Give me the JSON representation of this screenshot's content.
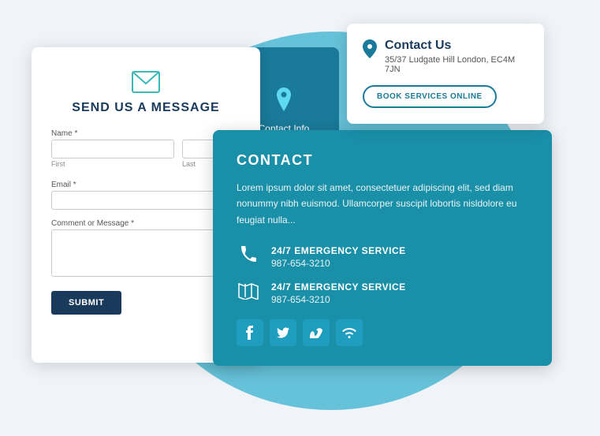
{
  "background": {
    "blob_color": "#4db8d4"
  },
  "form_card": {
    "title": "SEND US A MESSAGE",
    "envelope_icon": "✉",
    "name_label": "Name *",
    "name_first_label": "First",
    "name_last_label": "Last",
    "email_label": "Email *",
    "comment_label": "Comment or Message *",
    "submit_label": "SUBMIT"
  },
  "tab_card": {
    "pin_icon": "📍",
    "label": "Contact Info"
  },
  "contact_us_card": {
    "pin_icon": "📍",
    "title": "Contact Us",
    "address": "35/37 Ludgate Hill London, EC4M 7JN",
    "book_btn": "BOOK SERVICES ONLINE"
  },
  "main_contact_card": {
    "title": "CONTACT",
    "description": "Lorem ipsum dolor sit amet, consectetuer adipiscing elit, sed diam nonummy nibh euismod. Ullamcorper suscipit lobortis nisldolore eu feugiat nulla...",
    "service1": {
      "icon": "📞",
      "title": "24/7 EMERGENCY SERVICE",
      "phone": "987-654-3210"
    },
    "service2": {
      "icon": "🗺",
      "title": "24/7 EMERGENCY SERVICE",
      "phone": "987-654-3210"
    },
    "social": {
      "facebook": "f",
      "twitter": "t",
      "vimeo": "v",
      "wifi": "⊕"
    }
  }
}
